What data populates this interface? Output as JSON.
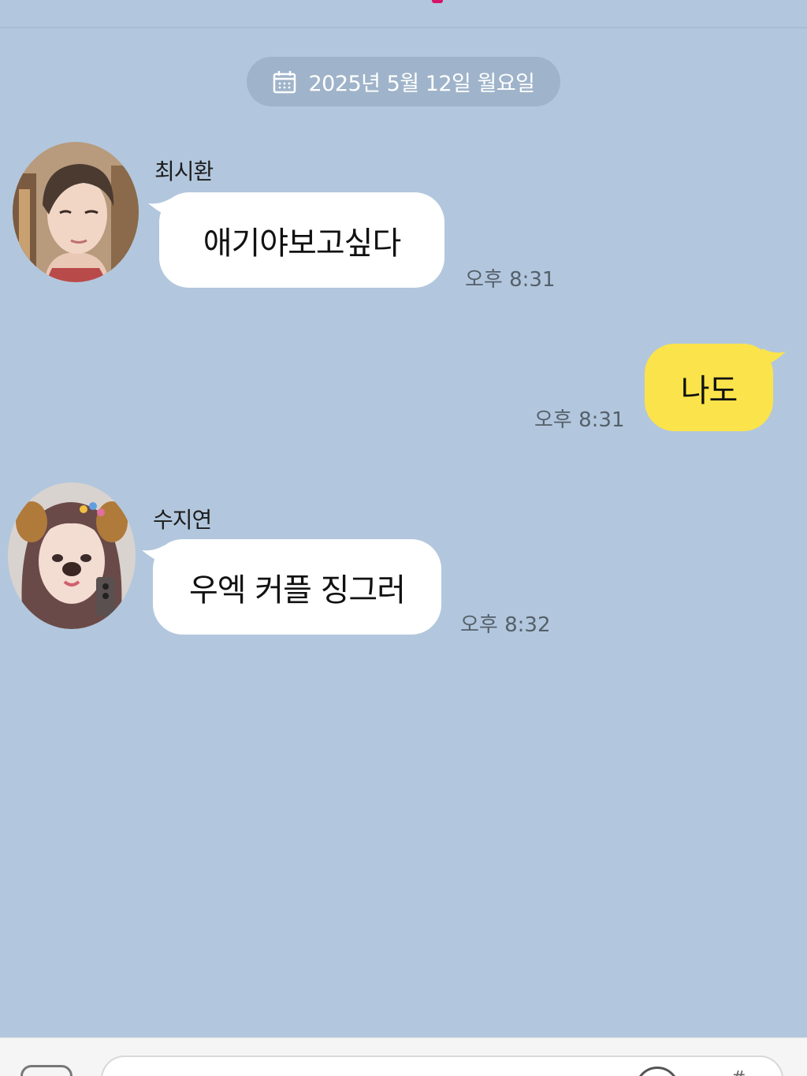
{
  "date_divider": {
    "icon": "calendar-icon",
    "text": "2025년 5월 12일 월요일"
  },
  "messages": [
    {
      "sender": "최시환",
      "text": "애기야보고싶다",
      "time": "오후 8:31",
      "mine": false
    },
    {
      "sender": "",
      "text": "나도",
      "time": "오후 8:31",
      "mine": true
    },
    {
      "sender": "수지연",
      "text": "우엑 커플 징그러",
      "time": "오후 8:32",
      "mine": false
    }
  ],
  "colors": {
    "chat_background": "#b2c7dd",
    "my_bubble": "#fbe34b",
    "other_bubble": "#ffffff",
    "date_pill": "#9fb4ca"
  }
}
